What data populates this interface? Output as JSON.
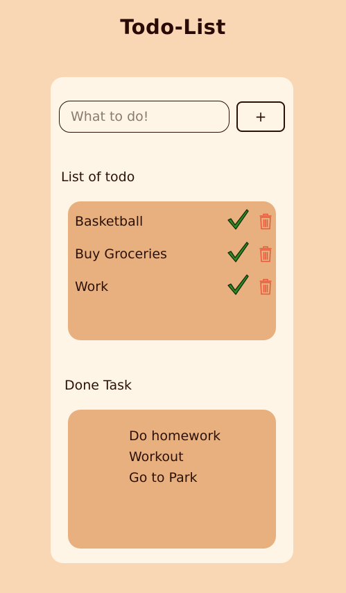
{
  "header": {
    "title": "Todo-List"
  },
  "input": {
    "placeholder": "What to do!",
    "value": ""
  },
  "add_button": {
    "label": "+"
  },
  "todo_section": {
    "label": "List of todo",
    "items": [
      {
        "text": "Basketball",
        "check_icon": "checkmark-icon",
        "delete_icon": "trash-icon"
      },
      {
        "text": "Buy Groceries",
        "check_icon": "checkmark-icon",
        "delete_icon": "trash-icon"
      },
      {
        "text": "Work",
        "check_icon": "checkmark-icon",
        "delete_icon": "trash-icon"
      }
    ]
  },
  "done_section": {
    "label": "Done Task",
    "items": [
      "Do homework",
      "Workout",
      "Go to Park"
    ]
  },
  "colors": {
    "page_background": "#f9d7b5",
    "card_background": "#fff5e6",
    "panel_background": "#e8b07e",
    "text": "#2a1006",
    "check": "#2e8b1e",
    "trash": "#e8573a"
  }
}
